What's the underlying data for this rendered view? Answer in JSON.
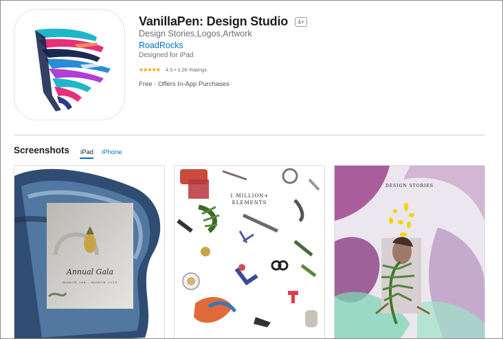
{
  "app": {
    "title": "VanillaPen: Design Studio",
    "age_rating": "4+",
    "subtitle": "Design Stories,Logos,Artwork",
    "developer": "RoadRocks",
    "designed_for": "Designed for iPad",
    "stars": "★★★★★",
    "rating": "4.5 • 3.2K Ratings",
    "price": "Free · Offers In-App Purchases"
  },
  "screenshots": {
    "heading": "Screenshots",
    "tabs": [
      {
        "label": "iPad",
        "active": true
      },
      {
        "label": "iPhone",
        "active": false
      }
    ],
    "items": [
      {
        "caption": "Annual Gala",
        "date_line": "MARCH 2nd – MARCH 2018"
      },
      {
        "caption_line1": "1 MILLION+",
        "caption_line2": "ELEMENTS"
      },
      {
        "caption": "DESIGN STORIES"
      }
    ]
  },
  "colors": {
    "link": "#0070c9",
    "star": "#ff9500",
    "text_secondary": "#6e6e73"
  }
}
